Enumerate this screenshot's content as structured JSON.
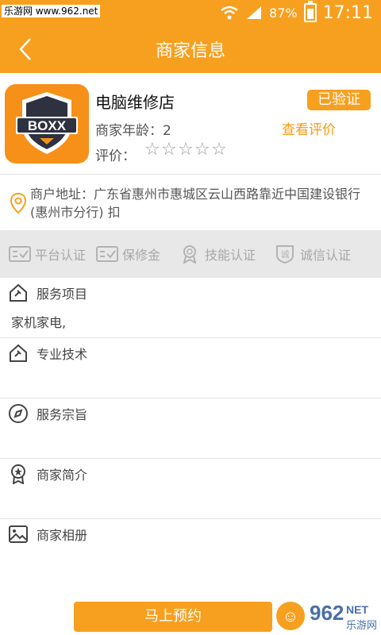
{
  "status_bar": {
    "watermark": "乐游网 www.962.net",
    "battery_percent": "87%",
    "time": "17:11"
  },
  "nav": {
    "title": "商家信息"
  },
  "merchant": {
    "name": "电脑维修店",
    "verified_badge": "已验证",
    "age_label": "商家年龄：2",
    "view_reviews": "查看评价",
    "rating_label": "评价：",
    "rating_stars": 5,
    "rating_value": 0,
    "logo_text": "BOXX",
    "address": "商户地址：广东省惠州市惠城区云山西路靠近中国建设银行(惠州市分行)  扣"
  },
  "certifications": [
    {
      "label": "平台认证",
      "icon": "certificate-icon"
    },
    {
      "label": "保修金",
      "icon": "warranty-icon"
    },
    {
      "label": "技能认证",
      "icon": "award-icon"
    },
    {
      "label": "诚信认证",
      "icon": "honesty-icon"
    }
  ],
  "sections": [
    {
      "title": "服务项目",
      "content": "家机家电,",
      "icon": "service-icon"
    },
    {
      "title": "专业技术",
      "content": "",
      "icon": "tech-icon"
    },
    {
      "title": "服务宗旨",
      "content": "",
      "icon": "compass-icon"
    },
    {
      "title": "商家简介",
      "content": "",
      "icon": "profile-icon"
    },
    {
      "title": "商家相册",
      "content": "",
      "icon": "album-icon"
    }
  ],
  "footer": {
    "book_button": "马上预约",
    "logo_text": "962",
    "logo_sub": "乐游网",
    "logo_domain": "NET"
  },
  "colors": {
    "primary": "#f7a01f",
    "link": "#f79a12",
    "cert_bg": "#e8e8e8",
    "muted": "#a8a8a8"
  }
}
